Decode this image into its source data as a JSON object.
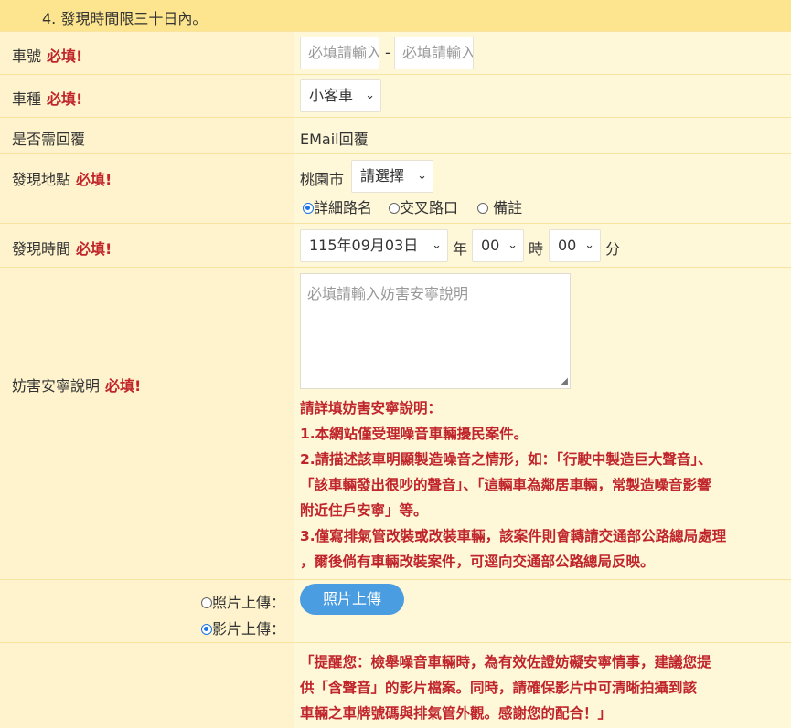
{
  "top_note": "4. 發現時間限三十日內。",
  "required_mark": "必填!",
  "rows": {
    "plate": {
      "label": "車號",
      "placeholder_1": "必填請輸入",
      "separator": "-",
      "placeholder_2": "必填請輸入"
    },
    "vehicle_type": {
      "label": "車種",
      "selected": "小客車"
    },
    "reply": {
      "label": "是否需回覆",
      "value": "EMail回覆"
    },
    "location": {
      "label": "發現地點",
      "city": "桃園市",
      "district_selected": "請選擇",
      "options": [
        "詳細路名",
        "交叉路口",
        "備註"
      ],
      "checked": "詳細路名"
    },
    "time": {
      "label": "發現時間",
      "date_selected": "115年09月03日",
      "unit_year": "年",
      "hour_selected": "00",
      "unit_hour": "時",
      "minute_selected": "00",
      "unit_minute": "分"
    },
    "description": {
      "label": "妨害安寧說明",
      "placeholder": "必填請輸入妨害安寧說明",
      "notes": [
        "請詳填妨害安寧說明：",
        "1.本網站僅受理噪音車輛擾民案件。",
        "2.請描述該車明顯製造噪音之情形，如：「行駛中製造巨大聲音」、",
        "「該車輛發出很吵的聲音」、「這輛車為鄰居車輛，常製造噪音影響",
        "附近住戶安寧」等。",
        "3.僅寫排氣管改裝或改裝車輛，該案件則會轉請交通部公路總局處理",
        "，爾後倘有車輛改裝案件，可逕向交通部公路總局反映。"
      ]
    },
    "upload": {
      "option_photo": "照片上傳：",
      "option_video": "影片上傳：",
      "checked": "video",
      "button_label": "照片上傳"
    },
    "reminder": {
      "lines": [
        "「提醒您：檢舉噪音車輛時，為有效佐證妨礙安寧情事，建議您提",
        "供「含聲音」的影片檔案。同時，請確保影片中可清晰拍攝到該",
        "車輛之車牌號碼與排氣管外觀。感謝您的配合！」"
      ]
    }
  },
  "colors": {
    "required": "#c0252b",
    "accent": "#4a9de0",
    "radio_checked": "#1a73e8"
  }
}
